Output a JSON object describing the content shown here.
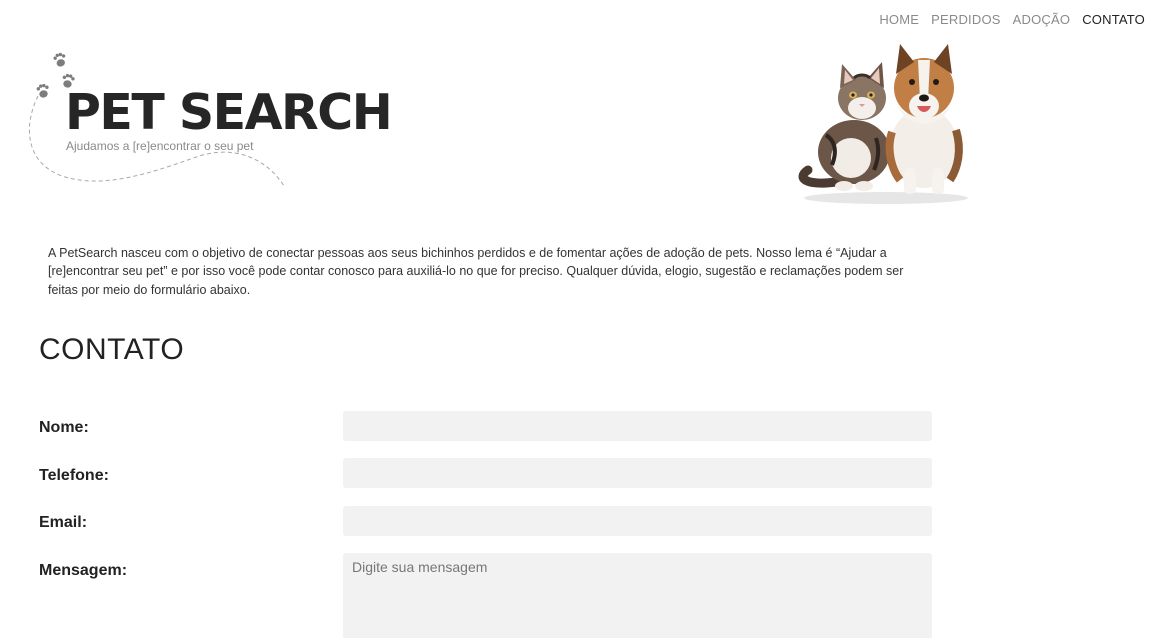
{
  "nav": {
    "items": [
      {
        "label": "HOME",
        "active": false
      },
      {
        "label": "PERDIDOS",
        "active": false
      },
      {
        "label": "ADOÇÃO",
        "active": false
      },
      {
        "label": "CONTATO",
        "active": true
      }
    ]
  },
  "logo": {
    "title": "PET SEARCH",
    "tagline": "Ajudamos a [re]encontrar o seu pet"
  },
  "intro": {
    "text": "A PetSearch nasceu com o objetivo de conectar pessoas aos seus bichinhos perdidos e de fomentar ações de adoção de pets. Nosso lema é “Ajudar a [re]encontrar seu pet” e por isso você pode contar conosco para auxiliá-lo no que for preciso. Qualquer dúvida, elogio, sugestão e reclamações podem ser feitas por meio do formulário abaixo."
  },
  "contact": {
    "title": "CONTATO",
    "fields": {
      "name_label": "Nome:",
      "phone_label": "Telefone:",
      "email_label": "Email:",
      "message_label": "Mensagem:",
      "message_placeholder": "Digite sua mensagem"
    }
  },
  "icons": {
    "paw": "paw-print-icon",
    "pets_image": "cat-and-dog-illustration"
  },
  "colors": {
    "text_dark": "#222222",
    "nav_muted": "#8a8a8a",
    "input_bg": "#f2f2f2"
  }
}
